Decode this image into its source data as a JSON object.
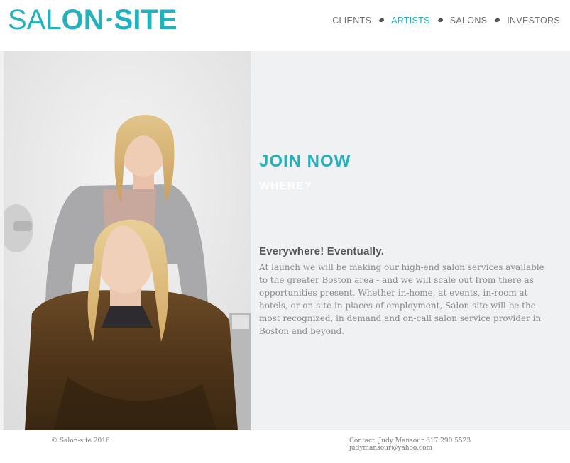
{
  "header": {
    "logo": {
      "part1": "SAL",
      "part2": "ON",
      "part3": "SITE"
    },
    "nav": {
      "items": [
        {
          "label": "CLIENTS"
        },
        {
          "label": "ARTISTS",
          "active": true
        },
        {
          "label": "SALONS"
        },
        {
          "label": "INVESTORS"
        }
      ]
    }
  },
  "main": {
    "title": "JOIN NOW",
    "subtitle": "WHERE?",
    "heading": "Everywhere! Eventually.",
    "body": "At launch we will be making our high-end salon services available to the greater Boston area - and we will scale out from there as opportunities present. Whether in-home, at events, in-room at hotels, or on-site in places of employment, Salon-site will be the most recognized, in demand and on-call salon service provider in Boston and beyond."
  },
  "footer": {
    "copyright": "© Salon-site 2016",
    "contact_line1": "Contact: Judy Mansour 617.290.5523",
    "contact_line2": "judymansour@yahoo.com"
  },
  "colors": {
    "accent": "#22b1bd",
    "nav_text": "#6f6f6f",
    "main_bg": "#f0f1f3",
    "body_text": "#8a8a8a"
  }
}
